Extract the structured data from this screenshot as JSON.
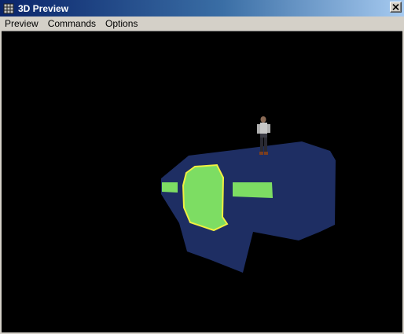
{
  "window": {
    "title": "3D Preview",
    "app_icon": "film-grid-icon",
    "close_icon": "close-x-icon"
  },
  "menubar": {
    "items": [
      "Preview",
      "Commands",
      "Options"
    ]
  },
  "viewport": {
    "background": "#000000",
    "platform_color": "#1e2e63",
    "panel_color": "#7ddd63",
    "panel_outline_color": "#f0f040",
    "character_icon": "human-figure-icon"
  }
}
